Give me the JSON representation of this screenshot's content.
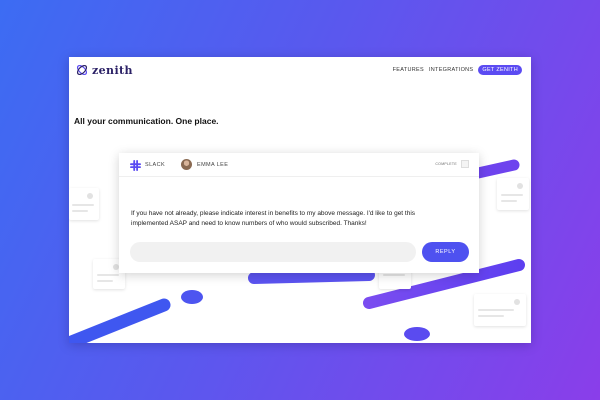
{
  "brand": {
    "name": "zenith"
  },
  "nav": {
    "items": [
      "FEATURES",
      "INTEGRATIONS"
    ],
    "cta": "GET ZENITH"
  },
  "hero": {
    "headline": "All your communication. One place."
  },
  "message_card": {
    "source": "SLACK",
    "user": "EMMA LEE",
    "status_label": "COMPLETE",
    "body": "If you have not already, please indicate interest in benefits to my above message. I'd like to get this implemented ASAP and need to know numbers of who would subscribed. Thanks!",
    "reply_placeholder": "",
    "reply_label": "REPLY"
  },
  "icons": {
    "logo": "zenith-logo-icon",
    "source": "slack-icon",
    "avatar": "avatar"
  },
  "colors": {
    "accent": "#5b4bf2",
    "button": "#4e51f0",
    "gradient_start": "#3c6cf3",
    "gradient_end": "#8a3eea"
  }
}
